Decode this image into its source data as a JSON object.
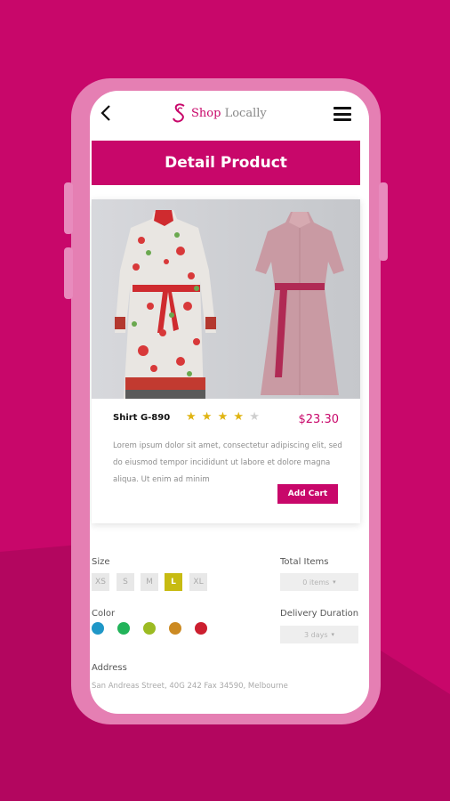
{
  "app": {
    "logo_main": "Shop",
    "logo_sub": "Locally"
  },
  "page": {
    "title": "Detail Product"
  },
  "product": {
    "name": "Shirt G-890",
    "rating": 4,
    "rating_max": 5,
    "price": "$23.30",
    "description": "Lorem ipsum dolor sit amet, consectetur adipiscing elit, sed do eiusmod tempor incididunt ut labore et dolore magna aliqua. Ut enim ad minim",
    "add_cart_label": "Add Cart"
  },
  "options": {
    "size_label": "Size",
    "sizes": [
      "XS",
      "S",
      "M",
      "L",
      "XL"
    ],
    "selected_size": "L",
    "color_label": "Color",
    "colors": [
      "#1f97c7",
      "#22b35a",
      "#9cbb22",
      "#cc8a22",
      "#cc1f2f"
    ],
    "total_items_label": "Total Items",
    "total_items_value": "0 items",
    "delivery_label": "Delivery Duration",
    "delivery_value": "3 days",
    "address_label": "Address",
    "address_value": "San Andreas Street, 40G 242 Fax 34590, Melbourne"
  },
  "theme": {
    "primary": "#c8076a",
    "accent": "#c7bb12"
  }
}
